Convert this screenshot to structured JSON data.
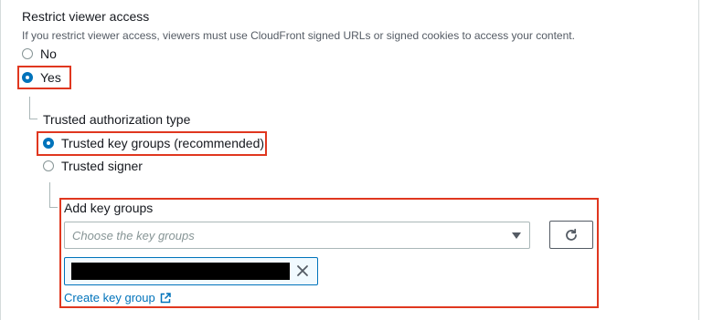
{
  "restrict_viewer_access": {
    "title": "Restrict viewer access",
    "description": "If you restrict viewer access, viewers must use CloudFront signed URLs or signed cookies to access your content.",
    "options": [
      {
        "label": "No",
        "selected": false
      },
      {
        "label": "Yes",
        "selected": true
      }
    ]
  },
  "trusted_authorization_type": {
    "title": "Trusted authorization type",
    "options": [
      {
        "label": "Trusted key groups (recommended)",
        "selected": true
      },
      {
        "label": "Trusted signer",
        "selected": false
      }
    ]
  },
  "key_groups": {
    "label": "Add key groups",
    "select_placeholder": "Choose the key groups",
    "selected_token": "",
    "create_link_label": "Create key group"
  },
  "icons": {
    "refresh": "refresh-icon",
    "dismiss": "close-icon",
    "external_link": "external-link-icon",
    "caret": "caret-down-icon"
  },
  "colors": {
    "accent": "#0073bb",
    "highlight": "#e0371f",
    "text": "#16191f",
    "secondary_text": "#545b64"
  }
}
